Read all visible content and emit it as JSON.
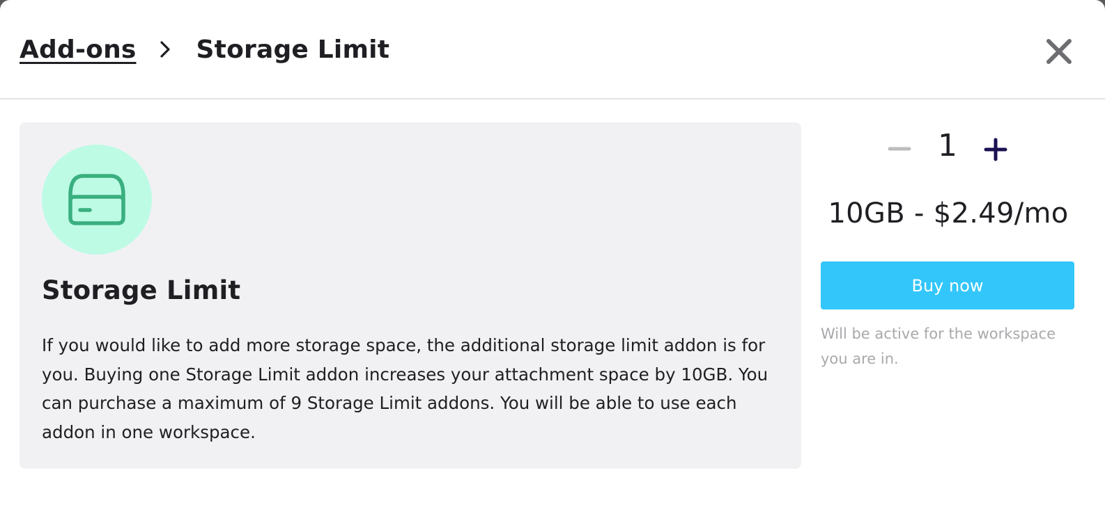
{
  "breadcrumb": {
    "parent_label": "Add-ons",
    "current_label": "Storage Limit"
  },
  "addon": {
    "title": "Storage Limit",
    "description": "If you would like to add more storage space, the additional storage limit addon is for you. Buying one Storage Limit addon increases your attachment space by 10GB. You can purchase a maximum of 9 Storage Limit addons. You will be able to use each addon in one workspace.",
    "icon": "storage-drive-icon"
  },
  "purchase": {
    "quantity": "1",
    "price_label": "10GB - $2.49/mo",
    "buy_label": "Buy now",
    "note": "Will be active for the workspace you are in."
  },
  "colors": {
    "accent_button": "#33c6fb",
    "icon_background": "#bdfbe5",
    "icon_stroke": "#3aaf7f",
    "card_background": "#f1f1f3",
    "plus_color": "#1a1052",
    "minus_color": "#bdbdbd"
  }
}
